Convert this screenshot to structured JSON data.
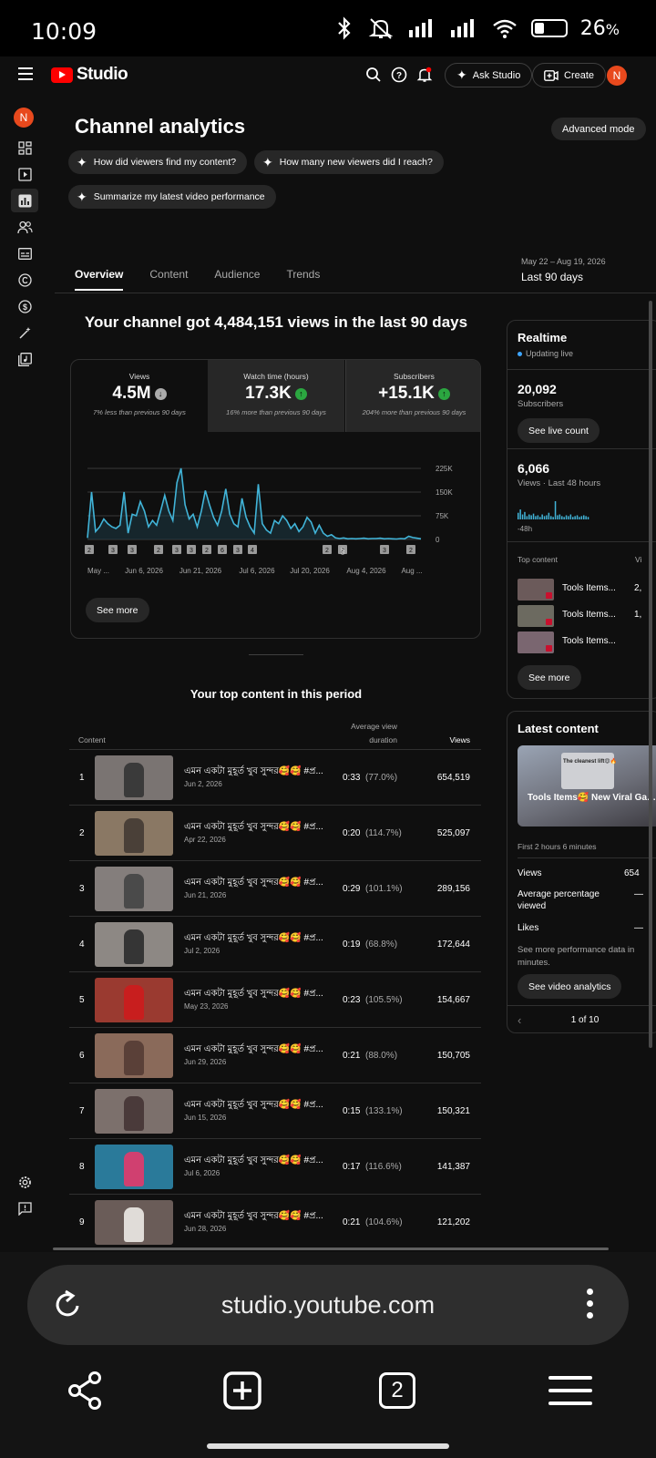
{
  "status": {
    "time": "10:09",
    "battery": "26",
    "battery_pct_sign": "%"
  },
  "topbar": {
    "brand": "Studio",
    "ask_label": "Ask Studio",
    "create_label": "Create",
    "avatar_letter": "N"
  },
  "sidebar": {
    "avatar_letter": "N"
  },
  "page": {
    "title": "Channel analytics",
    "advanced_mode": "Advanced mode",
    "chips": [
      "How did viewers find my content?",
      "How many new viewers did I reach?",
      "Summarize my latest video performance"
    ],
    "tabs": [
      "Overview",
      "Content",
      "Audience",
      "Trends"
    ],
    "range_sub": "May 22 – Aug 19, 2026",
    "range_main": "Last 90 days",
    "headline": "Your channel got 4,484,151 views in the last 90 days"
  },
  "metrics": [
    {
      "label": "Views",
      "value": "4.5M",
      "trend": "down",
      "note": "7% less than previous 90 days"
    },
    {
      "label": "Watch time (hours)",
      "value": "17.3K",
      "trend": "up",
      "note": "16% more than previous 90 days"
    },
    {
      "label": "Subscribers",
      "value": "+15.1K",
      "trend": "up",
      "note": "204% more than previous 90 days"
    }
  ],
  "chart_data": {
    "type": "area",
    "y_ticks": [
      "225K",
      "150K",
      "75K",
      "0"
    ],
    "ylim": [
      0,
      225000
    ],
    "x_labels": [
      "May ...",
      "Jun 6, 2026",
      "Jun 21, 2026",
      "Jul 6, 2026",
      "Jul 20, 2026",
      "Aug 4, 2026",
      "Aug ..."
    ],
    "values": [
      5000,
      150000,
      25000,
      40000,
      65000,
      50000,
      40000,
      35000,
      45000,
      150000,
      20000,
      80000,
      75000,
      120000,
      90000,
      40000,
      60000,
      45000,
      90000,
      140000,
      90000,
      60000,
      180000,
      225000,
      110000,
      65000,
      80000,
      40000,
      90000,
      155000,
      110000,
      70000,
      45000,
      90000,
      160000,
      80000,
      50000,
      40000,
      130000,
      70000,
      40000,
      20000,
      175000,
      50000,
      30000,
      20000,
      60000,
      50000,
      75000,
      60000,
      35000,
      50000,
      25000,
      40000,
      70000,
      55000,
      20000,
      45000,
      20000,
      10000,
      15000,
      5000,
      3000,
      5000,
      2000,
      3000,
      2000,
      3000,
      4000,
      2000,
      3000,
      3000,
      4000,
      2000,
      3000,
      2000,
      1500,
      3000,
      2000,
      10000,
      6000,
      4000,
      2000
    ],
    "markers": [
      "2",
      "3",
      "3",
      "2",
      "3",
      "3",
      "2",
      "6",
      "3",
      "4",
      "2",
      "2",
      "3",
      "2"
    ],
    "grid": true,
    "legend": "none"
  },
  "chart_see_more": "See more",
  "top_content": {
    "title": "Your top content in this period",
    "col_content": "Content",
    "col_avd_1": "Average view",
    "col_avd_2": "duration",
    "col_views": "Views",
    "rows": [
      {
        "rank": "1",
        "title": "এমন একটা মুহূর্ত খুব সুন্দর🥰🥰 #প্র...",
        "date": "Jun 2, 2026",
        "dur": "0:33",
        "pct": "(77.0%)",
        "views": "654,519",
        "bg": "#7a7472",
        "fig": "#3a3a3a"
      },
      {
        "rank": "2",
        "title": "এমন একটা মুহূর্ত খুব সুন্দর🥰🥰 #প্র...",
        "date": "Apr 22, 2026",
        "dur": "0:20",
        "pct": "(114.7%)",
        "views": "525,097",
        "bg": "#8a7864",
        "fig": "#4a4038"
      },
      {
        "rank": "3",
        "title": "এমন একটা মুহূর্ত খুব সুন্দর🥰🥰 #প্র...",
        "date": "Jun 21, 2026",
        "dur": "0:29",
        "pct": "(101.1%)",
        "views": "289,156",
        "bg": "#847e7c",
        "fig": "#4a4a4a"
      },
      {
        "rank": "4",
        "title": "এমন একটা মুহূর্ত খুব সুন্দর🥰🥰 #প্র...",
        "date": "Jul 2, 2026",
        "dur": "0:19",
        "pct": "(68.8%)",
        "views": "172,644",
        "bg": "#8d8884",
        "fig": "#353535"
      },
      {
        "rank": "5",
        "title": "এমন একটা মুহূর্ত খুব সুন্দর🥰🥰 #প্র...",
        "date": "May 23, 2026",
        "dur": "0:23",
        "pct": "(105.5%)",
        "views": "154,667",
        "bg": "#9a3a30",
        "fig": "#c81e1e"
      },
      {
        "rank": "6",
        "title": "এমন একটা মুহূর্ত খুব সুন্দর🥰🥰 #প্র...",
        "date": "Jun 29, 2026",
        "dur": "0:21",
        "pct": "(88.0%)",
        "views": "150,705",
        "bg": "#8a6a5a",
        "fig": "#5a4038"
      },
      {
        "rank": "7",
        "title": "এমন একটা মুহূর্ত খুব সুন্দর🥰🥰 #প্র...",
        "date": "Jun 15, 2026",
        "dur": "0:15",
        "pct": "(133.1%)",
        "views": "150,321",
        "bg": "#7c706c",
        "fig": "#4a3a3a"
      },
      {
        "rank": "8",
        "title": "এমন একটা মুহূর্ত খুব সুন্দর🥰🥰 #প্র...",
        "date": "Jul 6, 2026",
        "dur": "0:17",
        "pct": "(116.6%)",
        "views": "141,387",
        "bg": "#2a7a9a",
        "fig": "#d04070"
      },
      {
        "rank": "9",
        "title": "এমন একটা মুহূর্ত খুব সুন্দর🥰🥰 #প্র...",
        "date": "Jun 28, 2026",
        "dur": "0:21",
        "pct": "(104.6%)",
        "views": "121,202",
        "bg": "#6a5c58",
        "fig": "#e0dcd8"
      }
    ]
  },
  "realtime": {
    "title": "Realtime",
    "live": "Updating live",
    "subs_num": "20,092",
    "subs_label": "Subscribers",
    "see_live": "See live count",
    "views_num": "6,066",
    "views_label": "Views · Last 48 hours",
    "axis_left": "-48h",
    "bar_values": [
      8,
      12,
      6,
      9,
      4,
      6,
      5,
      7,
      4,
      5,
      3,
      6,
      4,
      5,
      8,
      4,
      3,
      22,
      5,
      6,
      4,
      3,
      5,
      4,
      6,
      3,
      4,
      5,
      3,
      4,
      5,
      4,
      3
    ],
    "top_content_label": "Top content",
    "top_content_col": "Vi",
    "items": [
      {
        "title": "Tools Items...",
        "num": "2,"
      },
      {
        "title": "Tools Items...",
        "num": "1,"
      },
      {
        "title": "Tools Items...",
        "num": ""
      }
    ],
    "see_more": "See more"
  },
  "latest": {
    "title": "Latest content",
    "thumb_top": "The cleanest lift😍🔥",
    "thumb_title": "Tools Items🥰 New Viral Gadgets, Smart, Kitchen...",
    "first": "First 2 hours 6 minutes",
    "views_k": "Views",
    "views_v": "654",
    "avg_k": "Average percentage viewed",
    "avg_v": "—",
    "likes_k": "Likes",
    "likes_v": "—",
    "more_text": "See more performance data in minutes.",
    "btn": "See video analytics",
    "pager": "1 of 10"
  },
  "browser": {
    "url": "studio.youtube.com",
    "tabs_count": "2"
  }
}
